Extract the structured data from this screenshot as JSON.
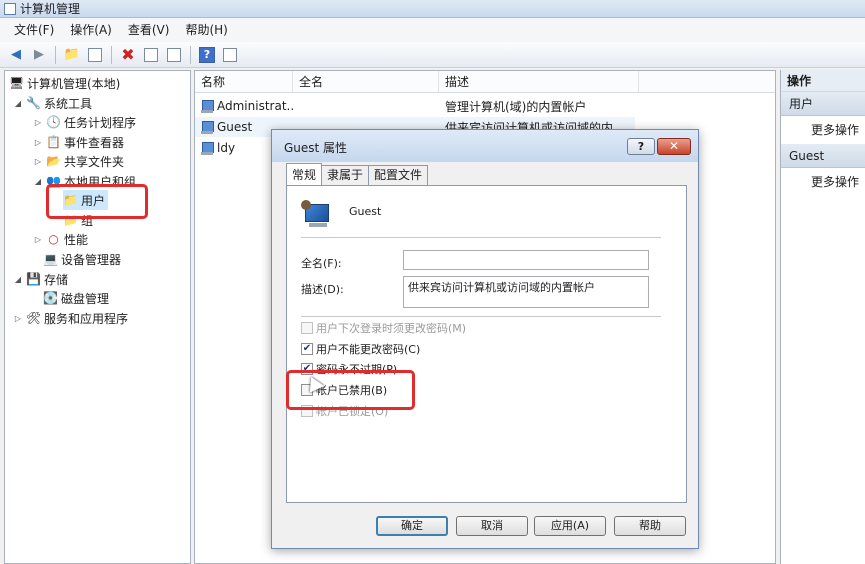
{
  "window": {
    "title": "计算机管理"
  },
  "menu": [
    "文件(F)",
    "操作(A)",
    "查看(V)",
    "帮助(H)"
  ],
  "toolbar": {
    "help_label": "?"
  },
  "tree": {
    "root": "计算机管理(本地)",
    "system_tools": "系统工具",
    "task_scheduler": "任务计划程序",
    "event_viewer": "事件查看器",
    "shared_folders": "共享文件夹",
    "local_users_groups": "本地用户和组",
    "users": "用户",
    "groups": "组",
    "performance": "性能",
    "device_manager": "设备管理器",
    "storage": "存储",
    "disk_management": "磁盘管理",
    "services_apps": "服务和应用程序"
  },
  "list": {
    "columns": [
      "名称",
      "全名",
      "描述"
    ],
    "rows": [
      {
        "name": "Administrat...",
        "full": "",
        "desc": "管理计算机(域)的内置帐户"
      },
      {
        "name": "Guest",
        "full": "",
        "desc": "供来宾访问计算机或访问域的内"
      },
      {
        "name": "ldy",
        "full": "",
        "desc": ""
      }
    ]
  },
  "actions": {
    "header": "操作",
    "section1": "用户",
    "section1_more": "更多操作",
    "section2": "Guest",
    "section2_more": "更多操作"
  },
  "dialog": {
    "title": "Guest 属性",
    "help_btn": "?",
    "close_btn": "✕",
    "tabs": [
      "常规",
      "隶属于",
      "配置文件"
    ],
    "username": "Guest",
    "fullname_label": "全名(F):",
    "fullname_value": "",
    "desc_label": "描述(D):",
    "desc_value": "供来宾访问计算机或访问域的内置帐户",
    "checkboxes": [
      {
        "label": "用户下次登录时须更改密码(M)",
        "checked": false,
        "disabled": true
      },
      {
        "label": "用户不能更改密码(C)",
        "checked": true,
        "disabled": false
      },
      {
        "label": "密码永不过期(P)",
        "checked": true,
        "disabled": false
      },
      {
        "label": "帐户已禁用(B)",
        "checked": false,
        "disabled": false
      },
      {
        "label": "帐户已锁定(O)",
        "checked": false,
        "disabled": true
      }
    ],
    "buttons": {
      "ok": "确定",
      "cancel": "取消",
      "apply": "应用(A)",
      "help": "帮助"
    }
  },
  "colors": {
    "highlight": "#e02c2c",
    "selection": "#cce8ff"
  }
}
